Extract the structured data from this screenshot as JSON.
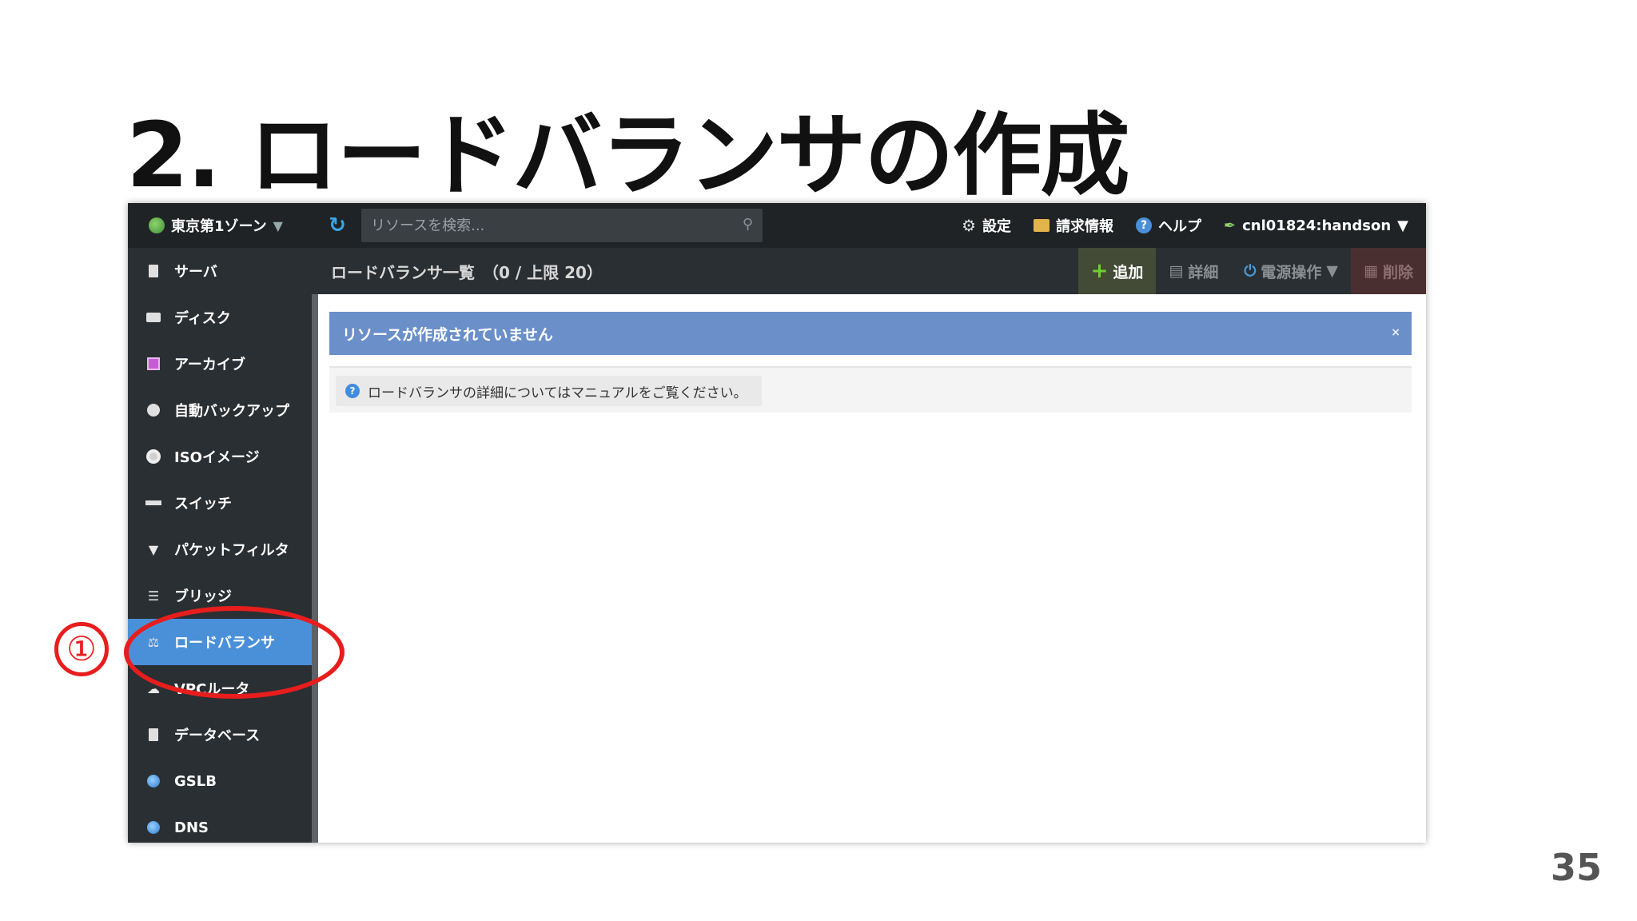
{
  "slide": {
    "title": "2. ロードバランサの作成",
    "page_number": "35",
    "step_marker": "①"
  },
  "topbar": {
    "zone": "東京第1ゾーン",
    "zone_caret": "▼",
    "refresh_icon": "↻",
    "search_placeholder": "リソースを検索...",
    "settings": "設定",
    "billing": "請求情報",
    "help": "ヘルプ",
    "user": "cnl01824:handson",
    "user_caret": "▼"
  },
  "sidebar": {
    "items": [
      {
        "label": "サーバ",
        "icon": "server-icon"
      },
      {
        "label": "ディスク",
        "icon": "disk-icon"
      },
      {
        "label": "アーカイブ",
        "icon": "archive-icon"
      },
      {
        "label": "自動バックアップ",
        "icon": "clock-icon"
      },
      {
        "label": "ISOイメージ",
        "icon": "cd-icon"
      },
      {
        "label": "スイッチ",
        "icon": "switch-icon"
      },
      {
        "label": "パケットフィルタ",
        "icon": "filter-icon"
      },
      {
        "label": "ブリッジ",
        "icon": "bridge-icon"
      },
      {
        "label": "ロードバランサ",
        "icon": "load-balancer-icon",
        "active": true
      },
      {
        "label": "VPCルータ",
        "icon": "cloud-icon"
      },
      {
        "label": "データベース",
        "icon": "database-icon"
      },
      {
        "label": "GSLB",
        "icon": "gslb-icon"
      },
      {
        "label": "DNS",
        "icon": "dns-icon"
      }
    ]
  },
  "header": {
    "list_title": "ロードバランサ一覧　（0 / 上限 20）",
    "actions": {
      "add": "追加",
      "detail": "詳細",
      "power": "電源操作",
      "power_caret": "▼",
      "delete": "削除"
    }
  },
  "main": {
    "alert": "リソースが作成されていません",
    "alert_close": "×",
    "info_icon": "?",
    "info": "ロードバランサの詳細についてはマニュアルをご覧ください。"
  },
  "colors": {
    "topbar": "#1f2326",
    "sidebar": "#2a2f33",
    "active_item": "#4a90d9",
    "alert": "#6a8fc9",
    "annotation": "#e81d1d"
  }
}
